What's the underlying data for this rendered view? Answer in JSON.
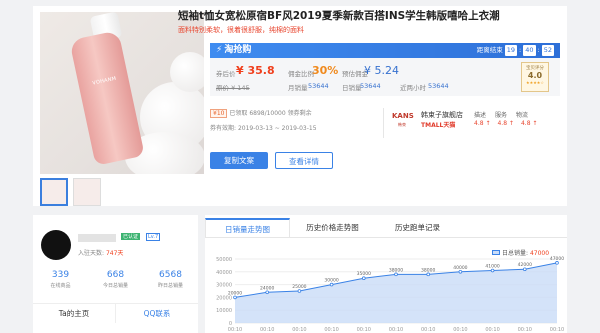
{
  "product": {
    "title": "短袖t恤女宽松原宿BF风2019夏季新款百搭INS学生韩版嘻哈上衣潮",
    "sub1": "面料特别柔软，很着很舒服，纯棉的面料",
    "sub2": "，",
    "image_label": "VOHANM",
    "thumbs": [
      "thumb-1",
      "thumb-2"
    ]
  },
  "promo": {
    "brand": "淘抢购",
    "countdown_label": "距离结束",
    "countdown": [
      "19",
      "40",
      "52"
    ]
  },
  "prices": {
    "after_label": "券后价",
    "after_value": "¥ 35.8",
    "original": "原价 ¥ 145",
    "commission_rate_label": "佣金比例",
    "commission_rate": "30%",
    "est_commission_label": "预估佣金",
    "est_commission": "¥ 5.24",
    "monthly_sales_label": "月销量",
    "monthly_sales": "53644",
    "daily_sales_label": "日销量",
    "daily_sales": "53644",
    "recent_label": "近两小时",
    "recent": "53644"
  },
  "score": {
    "title": "宝贝评分",
    "value": "4.0",
    "stars": "★★★★☆"
  },
  "coupon": {
    "tag": "¥10",
    "received_label": "已领取",
    "received": "6898/10000",
    "remain_label": "领券剩余",
    "valid_label": "券有效期:",
    "valid": "2019-03-13 ~ 2019-03-15"
  },
  "shop": {
    "brand": "KANS",
    "brand_sub": "韩束",
    "name": "韩束子旗舰店",
    "platform": "TMALL天猫",
    "rates_labels": [
      "描述",
      "服务",
      "物流"
    ],
    "rates_values": [
      "4.8 ↑",
      "4.8 ↑",
      "4.8 ↑"
    ]
  },
  "buttons": {
    "copy": "复制文案",
    "detail": "查看详情"
  },
  "user": {
    "tag_verified": "已认证",
    "tag_level": "Lv.7",
    "join_label": "入驻天数:",
    "join_days": "747天",
    "stats": [
      {
        "value": "339",
        "label": "在线商品"
      },
      {
        "value": "668",
        "label": "今日总销量"
      },
      {
        "value": "6568",
        "label": "昨日总销量"
      }
    ],
    "home": "Ta的主页",
    "qq": "QQ联系"
  },
  "chart_tabs": [
    "日销量走势图",
    "历史价格走势图",
    "历史跑单记录"
  ],
  "legend": {
    "label": "日总销量:",
    "value": "47000"
  },
  "colors": {
    "accent": "#3a82e6",
    "price": "#f0401e",
    "area": "#c9dcf8",
    "line": "#3a82e6"
  },
  "chart_data": {
    "type": "area",
    "x": [
      "00:10",
      "00:10",
      "00:10",
      "00:10",
      "00:10",
      "00:10",
      "00:10",
      "00:10",
      "00:10",
      "00:10",
      "00:10"
    ],
    "y_ticks": [
      0,
      10000,
      20000,
      30000,
      40000,
      50000
    ],
    "ylim": [
      0,
      50000
    ],
    "series": [
      {
        "values": [
          20000,
          24000,
          25000,
          30000,
          35000,
          38000,
          38000,
          40000,
          41000,
          42000,
          47000
        ]
      }
    ],
    "data_labels": [
      "20000",
      "24000",
      "25000",
      "30000",
      "35000",
      "38000",
      "38000",
      "40000",
      "41000",
      "42000",
      "47000"
    ],
    "grid": true
  }
}
